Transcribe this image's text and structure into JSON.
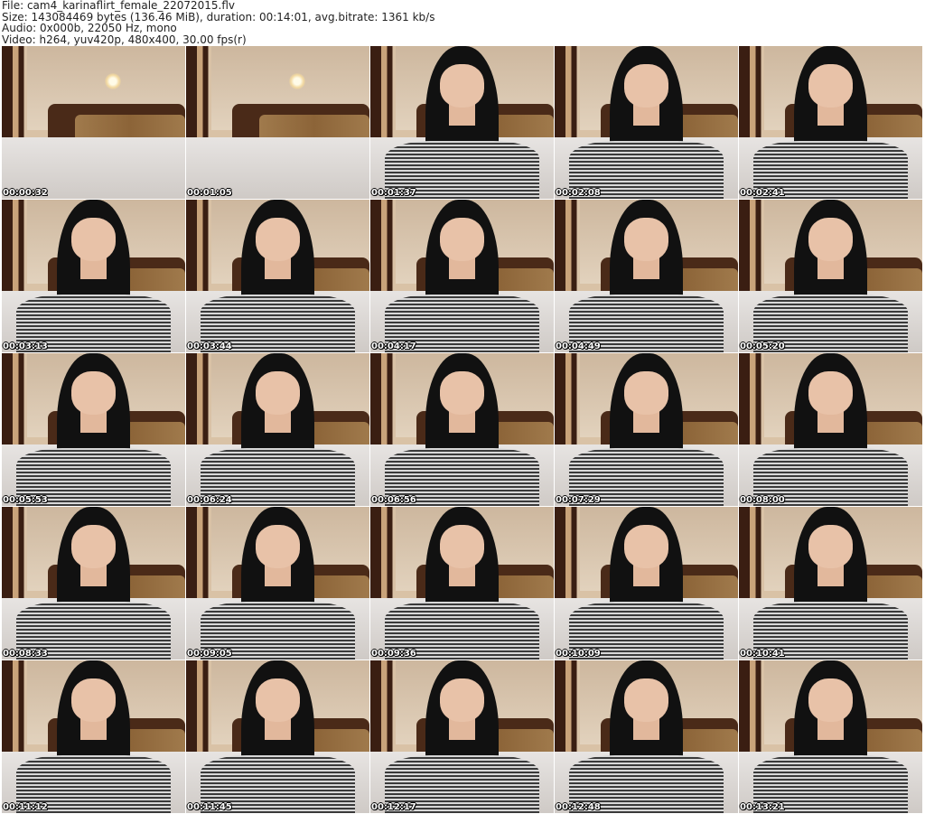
{
  "header": {
    "file": "File: cam4_karinaflirt_female_22072015.flv",
    "size": "Size: 143084469 bytes (136.46 MiB), duration: 00:14:01, avg.bitrate: 1361 kb/s",
    "audio": "Audio: 0x000b, 22050 Hz, mono",
    "video": "Video: h264, yuv420p, 480x400, 30.00 fps(r)"
  },
  "thumbnails": [
    {
      "time": "00:00:32",
      "person": false
    },
    {
      "time": "00:01:05",
      "person": false
    },
    {
      "time": "00:01:37",
      "person": true
    },
    {
      "time": "00:02:08",
      "person": true
    },
    {
      "time": "00:02:41",
      "person": true
    },
    {
      "time": "00:03:13",
      "person": true
    },
    {
      "time": "00:03:44",
      "person": true
    },
    {
      "time": "00:04:17",
      "person": true
    },
    {
      "time": "00:04:49",
      "person": true
    },
    {
      "time": "00:05:20",
      "person": true
    },
    {
      "time": "00:05:53",
      "person": true
    },
    {
      "time": "00:06:24",
      "person": true
    },
    {
      "time": "00:06:56",
      "person": true
    },
    {
      "time": "00:07:29",
      "person": true
    },
    {
      "time": "00:08:00",
      "person": true
    },
    {
      "time": "00:08:33",
      "person": true
    },
    {
      "time": "00:09:05",
      "person": true
    },
    {
      "time": "00:09:36",
      "person": true
    },
    {
      "time": "00:10:09",
      "person": true
    },
    {
      "time": "00:10:41",
      "person": true
    },
    {
      "time": "00:11:12",
      "person": true
    },
    {
      "time": "00:11:45",
      "person": true
    },
    {
      "time": "00:12:17",
      "person": true
    },
    {
      "time": "00:12:48",
      "person": true
    },
    {
      "time": "00:13:21",
      "person": true
    }
  ]
}
